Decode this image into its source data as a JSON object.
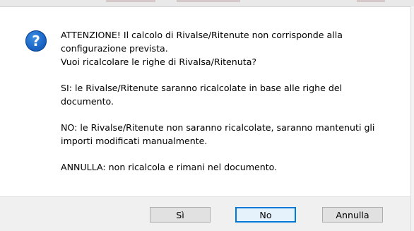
{
  "dialog": {
    "icon": "question-icon",
    "icon_glyph": "?",
    "message_lines": [
      "ATTENZIONE! Il calcolo di Rivalse/Ritenute non corrisponde alla configurazione prevista.",
      "Vuoi ricalcolare le righe di Rivalsa/Ritenuta?"
    ],
    "paragraphs": [
      "SI: le Rivalse/Ritenute saranno ricalcolate in base alle righe del documento.",
      "NO: le Rivalse/Ritenute non saranno ricalcolate, saranno mantenuti gli importi modificati manualmente.",
      "ANNULLA: non ricalcola e rimani nel documento."
    ],
    "buttons": {
      "yes_label": "Sì",
      "no_label": "No",
      "cancel_label": "Annulla"
    }
  },
  "colors": {
    "accent": "#0078d7",
    "icon_blue": "#1a63c4",
    "footer_bg": "#f0f0f0"
  }
}
